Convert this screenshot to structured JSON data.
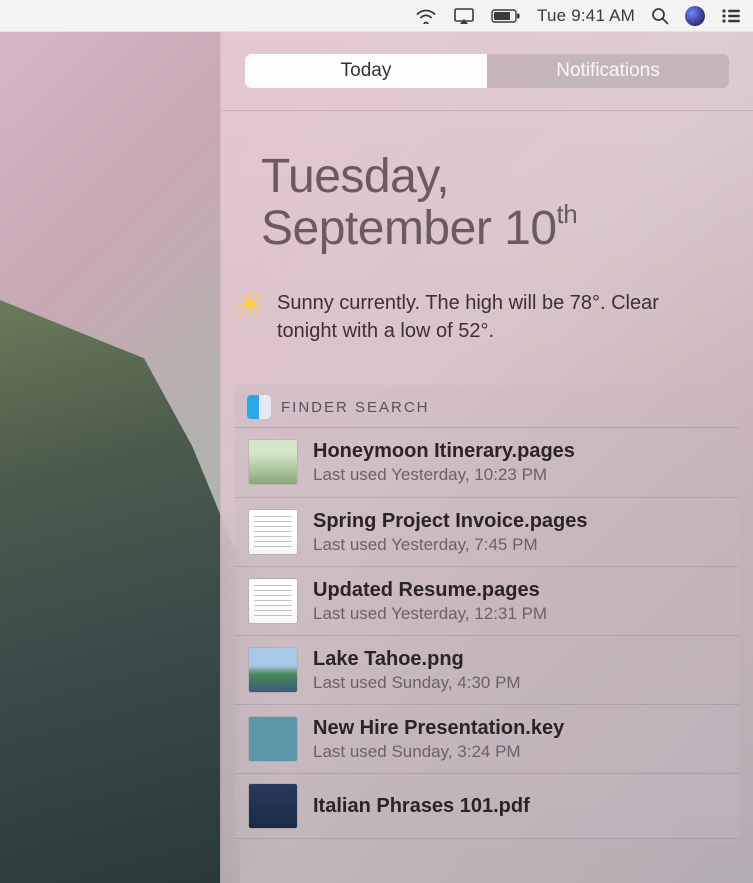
{
  "menubar": {
    "clock": "Tue 9:41 AM"
  },
  "tabs": {
    "today": "Today",
    "notifications": "Notifications"
  },
  "date": {
    "line1": "Tuesday,",
    "line2_prefix": "September 10",
    "line2_ord": "th"
  },
  "weather": {
    "text": "Sunny currently. The high will be 78°.  Clear tonight with a low of 52°."
  },
  "widget": {
    "title": "FINDER SEARCH",
    "files": [
      {
        "name": "Honeymoon Itinerary.pages",
        "meta": "Last used Yesterday, 10:23 PM",
        "thumb": "thumb-img1"
      },
      {
        "name": "Spring Project Invoice.pages",
        "meta": "Last used Yesterday, 7:45 PM",
        "thumb": "thumb-doc"
      },
      {
        "name": "Updated Resume.pages",
        "meta": "Last used Yesterday, 12:31 PM",
        "thumb": "thumb-doc"
      },
      {
        "name": "Lake Tahoe.png",
        "meta": "Last used Sunday, 4:30 PM",
        "thumb": "thumb-img2"
      },
      {
        "name": "New Hire Presentation.key",
        "meta": "Last used Sunday, 3:24 PM",
        "thumb": "thumb-key"
      },
      {
        "name": "Italian Phrases 101.pdf",
        "meta": "",
        "thumb": "thumb-pdf"
      }
    ]
  }
}
